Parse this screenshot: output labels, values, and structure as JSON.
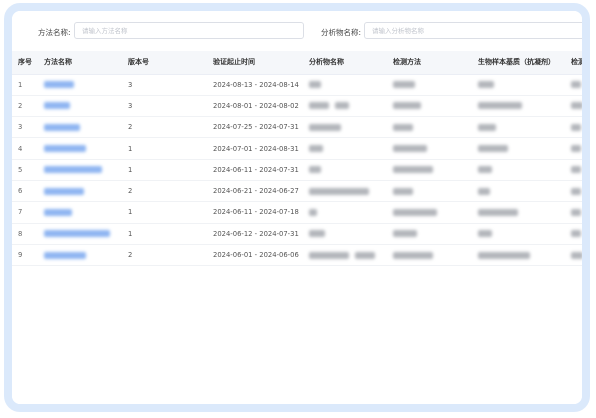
{
  "filters": [
    {
      "label": "方法名称:",
      "placeholder": "请输入方法名称"
    },
    {
      "label": "分析物名称:",
      "placeholder": "请输入分析物名称"
    }
  ],
  "columns": [
    "序号",
    "方法名称",
    "版本号",
    "验证起止时间",
    "分析物名称",
    "检测方法",
    "生物样本基质（抗凝剂）",
    "检测"
  ],
  "rows": [
    {
      "seq": "1",
      "version": "3",
      "period": "2024-08-13 - 2024-08-14"
    },
    {
      "seq": "2",
      "version": "3",
      "period": "2024-08-01 - 2024-08-02"
    },
    {
      "seq": "3",
      "version": "2",
      "period": "2024-07-25 - 2024-07-31"
    },
    {
      "seq": "4",
      "version": "1",
      "period": "2024-07-01 - 2024-08-31"
    },
    {
      "seq": "5",
      "version": "1",
      "period": "2024-06-11 - 2024-07-31"
    },
    {
      "seq": "6",
      "version": "2",
      "period": "2024-06-21 - 2024-06-27"
    },
    {
      "seq": "7",
      "version": "1",
      "period": "2024-06-11 - 2024-07-18"
    },
    {
      "seq": "8",
      "version": "1",
      "period": "2024-06-12 - 2024-07-31"
    },
    {
      "seq": "9",
      "version": "2",
      "period": "2024-06-01 - 2024-06-06"
    }
  ]
}
